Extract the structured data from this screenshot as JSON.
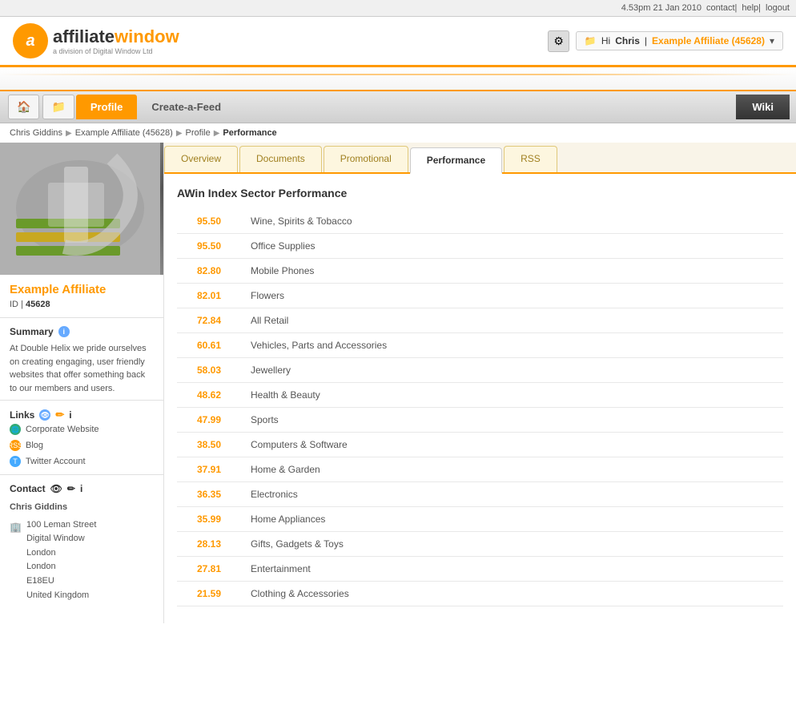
{
  "topbar": {
    "datetime": "4.53pm 21 Jan 2010",
    "contact": "contact",
    "help": "help",
    "logout": "logout"
  },
  "header": {
    "logo_letter": "a",
    "logo_main": "affiliate",
    "logo_bold": "window",
    "logo_sub": "a division of Digital Window Ltd",
    "greeting": "Hi",
    "username": "Chris",
    "affiliate_name": "Example Affiliate (45628)",
    "gear_icon": "⚙"
  },
  "nav": {
    "icon1": "🏠",
    "icon2": "📁",
    "profile_tab": "Profile",
    "create_tab": "Create-a-Feed",
    "wiki_tab": "Wiki"
  },
  "breadcrumb": {
    "items": [
      "Chris Giddins",
      "Example Affiliate (45628)",
      "Profile",
      "Performance"
    ]
  },
  "sidebar": {
    "affiliate_name": "Example Affiliate",
    "id_label": "ID",
    "id_value": "45628",
    "summary_title": "Summary",
    "summary_text": "At Double Helix we pride ourselves on creating engaging, user friendly websites that offer something back to our members and users.",
    "links_title": "Links",
    "links": [
      {
        "type": "globe",
        "label": "Corporate Website"
      },
      {
        "type": "rss",
        "label": "Blog"
      },
      {
        "type": "twitter",
        "label": "Twitter Account"
      }
    ],
    "contact_title": "Contact",
    "contact_name": "Chris Giddins",
    "address": "100 Leman Street\nDigital Window\nLondon\nLondon\nE18EU\nUnited Kingdom"
  },
  "tabs": {
    "items": [
      "Overview",
      "Documents",
      "Promotional",
      "Performance",
      "RSS"
    ],
    "active": "Performance"
  },
  "performance": {
    "title": "AWin Index Sector Performance",
    "rows": [
      {
        "score": "95.50",
        "label": "Wine, Spirits & Tobacco"
      },
      {
        "score": "95.50",
        "label": "Office Supplies"
      },
      {
        "score": "82.80",
        "label": "Mobile Phones"
      },
      {
        "score": "82.01",
        "label": "Flowers"
      },
      {
        "score": "72.84",
        "label": "All Retail"
      },
      {
        "score": "60.61",
        "label": "Vehicles, Parts and Accessories"
      },
      {
        "score": "58.03",
        "label": "Jewellery"
      },
      {
        "score": "48.62",
        "label": "Health & Beauty"
      },
      {
        "score": "47.99",
        "label": "Sports"
      },
      {
        "score": "38.50",
        "label": "Computers & Software"
      },
      {
        "score": "37.91",
        "label": "Home & Garden"
      },
      {
        "score": "36.35",
        "label": "Electronics"
      },
      {
        "score": "35.99",
        "label": "Home Appliances"
      },
      {
        "score": "28.13",
        "label": "Gifts, Gadgets & Toys"
      },
      {
        "score": "27.81",
        "label": "Entertainment"
      },
      {
        "score": "21.59",
        "label": "Clothing & Accessories"
      }
    ]
  }
}
